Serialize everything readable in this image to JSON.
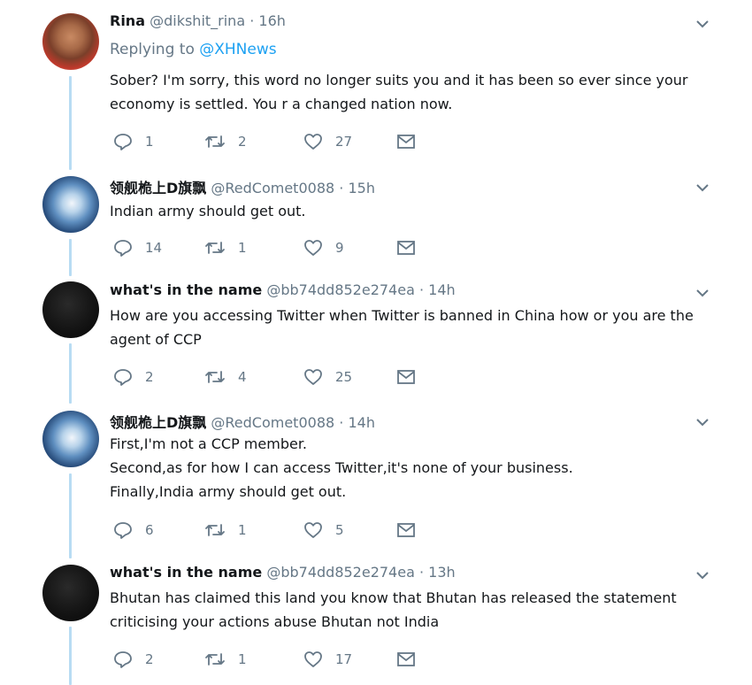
{
  "tweets": [
    {
      "display_name": "Rina",
      "handle": "@dikshit_rina",
      "separator": "·",
      "time": "16h",
      "replying_label": "Replying to",
      "replying_handle": "@XHNews",
      "text": "Sober? I'm sorry, this word no longer suits you and it has been so ever since your economy is settled. You r a changed nation now.",
      "replies": "1",
      "retweets": "2",
      "likes": "27"
    },
    {
      "display_name": "领舰桅上D旗飘",
      "handle": "@RedComet0088",
      "separator": "·",
      "time": "15h",
      "text": "Indian army should get out.",
      "replies": "14",
      "retweets": "1",
      "likes": "9"
    },
    {
      "display_name": "what's in the name",
      "handle": "@bb74dd852e274ea",
      "separator": "·",
      "time": "14h",
      "text": "How are you accessing Twitter when Twitter is banned in China how  or you are the agent of CCP",
      "replies": "2",
      "retweets": "4",
      "likes": "25"
    },
    {
      "display_name": "领舰桅上D旗飘",
      "handle": "@RedComet0088",
      "separator": "·",
      "time": "14h",
      "text_lines": [
        "First,I'm not a CCP member.",
        "Second,as for how I can access Twitter,it's none of your business.",
        "Finally,India army should get out."
      ],
      "replies": "6",
      "retweets": "1",
      "likes": "5"
    },
    {
      "display_name": "what's in the name",
      "handle": "@bb74dd852e274ea",
      "separator": "·",
      "time": "13h",
      "text": "Bhutan has claimed this land you know that Bhutan has released the statement criticising your actions abuse Bhutan not India",
      "replies": "2",
      "retweets": "1",
      "likes": "17"
    }
  ],
  "icons": {
    "reply": "reply-icon",
    "retweet": "retweet-icon",
    "like": "heart-icon",
    "dm": "envelope-icon",
    "more": "chevron-down-icon"
  },
  "colors": {
    "thread_line": "#b8dcf3",
    "link": "#1da1f2",
    "secondary_text": "#657786",
    "primary_text": "#14171a"
  }
}
